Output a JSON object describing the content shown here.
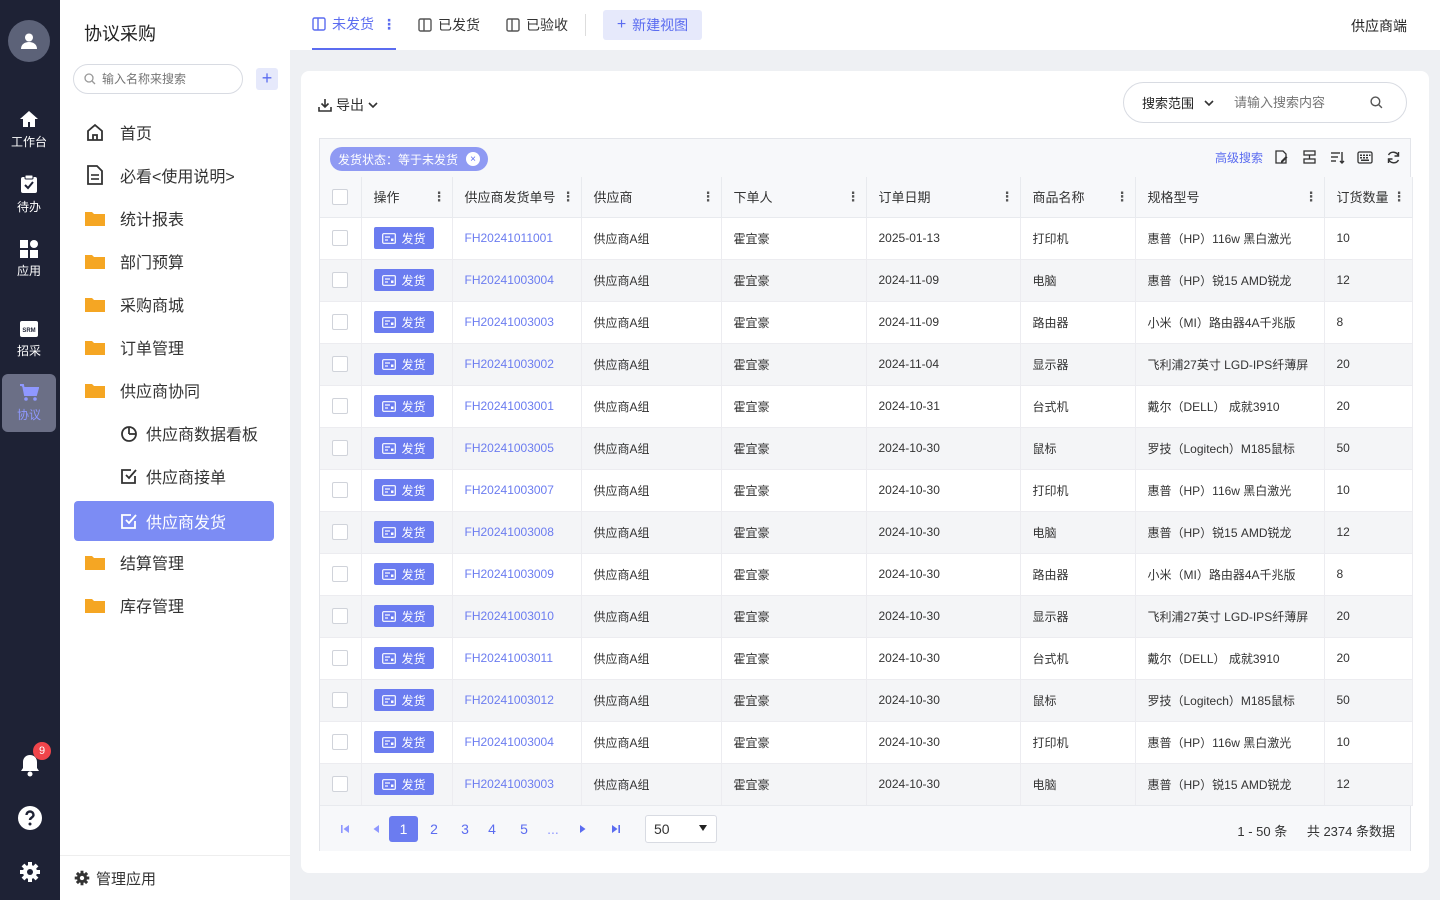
{
  "rail": {
    "items": [
      {
        "label": "工作台",
        "icon": "home-icon"
      },
      {
        "label": "待办",
        "icon": "clipboard-icon"
      },
      {
        "label": "应用",
        "icon": "apps-icon"
      },
      {
        "label": "招采",
        "icon": "srm-icon"
      },
      {
        "label": "协议",
        "icon": "cart-icon"
      }
    ],
    "badge_count": "9",
    "srm_text": "SRM"
  },
  "sidebar": {
    "title": "协议采购",
    "search_placeholder": "输入名称来搜索",
    "add_label": "+",
    "items": [
      {
        "label": "首页"
      },
      {
        "label": "必看<使用说明>"
      },
      {
        "label": "统计报表"
      },
      {
        "label": "部门预算"
      },
      {
        "label": "采购商城"
      },
      {
        "label": "订单管理"
      },
      {
        "label": "供应商协同"
      },
      {
        "label": "供应商数据看板"
      },
      {
        "label": "供应商接单"
      },
      {
        "label": "供应商发货"
      },
      {
        "label": "结算管理"
      },
      {
        "label": "库存管理"
      }
    ],
    "manage_label": "管理应用"
  },
  "topbar": {
    "tabs": [
      {
        "label": "未发货"
      },
      {
        "label": "已发货"
      },
      {
        "label": "已验收"
      }
    ],
    "tab_more": "⋮",
    "new_view_plus": "+",
    "new_view": "新建视图",
    "supplier_end": "供应商端"
  },
  "toolbar": {
    "export_label": "导出",
    "scope_label": "搜索范围",
    "search_placeholder": "请输入搜索内容",
    "filter_tag": "发货状态：等于未发货",
    "filter_close": "×",
    "advanced_search": "高级搜索"
  },
  "table": {
    "headers": [
      "操作",
      "供应商发货单号",
      "供应商",
      "下单人",
      "订单日期",
      "商品名称",
      "规格型号",
      "订货数量"
    ],
    "action_label": "发货",
    "rows": [
      {
        "no": "FH20241011001",
        "supplier": "供应商A组",
        "orderer": "霍宜豪",
        "date": "2025-01-13",
        "product": "打印机",
        "spec": "惠普（HP）116w 黑白激光",
        "qty": "10"
      },
      {
        "no": "FH20241003004",
        "supplier": "供应商A组",
        "orderer": "霍宜豪",
        "date": "2024-11-09",
        "product": "电脑",
        "spec": "惠普（HP）锐15 AMD锐龙",
        "qty": "12"
      },
      {
        "no": "FH20241003003",
        "supplier": "供应商A组",
        "orderer": "霍宜豪",
        "date": "2024-11-09",
        "product": "路由器",
        "spec": "小米（MI）路由器4A千兆版",
        "qty": "8"
      },
      {
        "no": "FH20241003002",
        "supplier": "供应商A组",
        "orderer": "霍宜豪",
        "date": "2024-11-04",
        "product": "显示器",
        "spec": "飞利浦27英寸 LGD-IPS纤薄屏",
        "qty": "20"
      },
      {
        "no": "FH20241003001",
        "supplier": "供应商A组",
        "orderer": "霍宜豪",
        "date": "2024-10-31",
        "product": "台式机",
        "spec": "戴尔（DELL） 成就3910",
        "qty": "20"
      },
      {
        "no": "FH20241003005",
        "supplier": "供应商A组",
        "orderer": "霍宜豪",
        "date": "2024-10-30",
        "product": "鼠标",
        "spec": "罗技（Logitech）M185鼠标",
        "qty": "50"
      },
      {
        "no": "FH20241003007",
        "supplier": "供应商A组",
        "orderer": "霍宜豪",
        "date": "2024-10-30",
        "product": "打印机",
        "spec": "惠普（HP）116w 黑白激光",
        "qty": "10"
      },
      {
        "no": "FH20241003008",
        "supplier": "供应商A组",
        "orderer": "霍宜豪",
        "date": "2024-10-30",
        "product": "电脑",
        "spec": "惠普（HP）锐15 AMD锐龙",
        "qty": "12"
      },
      {
        "no": "FH20241003009",
        "supplier": "供应商A组",
        "orderer": "霍宜豪",
        "date": "2024-10-30",
        "product": "路由器",
        "spec": "小米（MI）路由器4A千兆版",
        "qty": "8"
      },
      {
        "no": "FH20241003010",
        "supplier": "供应商A组",
        "orderer": "霍宜豪",
        "date": "2024-10-30",
        "product": "显示器",
        "spec": "飞利浦27英寸 LGD-IPS纤薄屏",
        "qty": "20"
      },
      {
        "no": "FH20241003011",
        "supplier": "供应商A组",
        "orderer": "霍宜豪",
        "date": "2024-10-30",
        "product": "台式机",
        "spec": "戴尔（DELL） 成就3910",
        "qty": "20"
      },
      {
        "no": "FH20241003012",
        "supplier": "供应商A组",
        "orderer": "霍宜豪",
        "date": "2024-10-30",
        "product": "鼠标",
        "spec": "罗技（Logitech）M185鼠标",
        "qty": "50"
      },
      {
        "no": "FH20241003004",
        "supplier": "供应商A组",
        "orderer": "霍宜豪",
        "date": "2024-10-30",
        "product": "打印机",
        "spec": "惠普（HP）116w 黑白激光",
        "qty": "10"
      },
      {
        "no": "FH20241003003",
        "supplier": "供应商A组",
        "orderer": "霍宜豪",
        "date": "2024-10-30",
        "product": "电脑",
        "spec": "惠普（HP）锐15 AMD锐龙",
        "qty": "12"
      }
    ]
  },
  "pagination": {
    "pages": [
      "1",
      "2",
      "3",
      "4",
      "5",
      "..."
    ],
    "current_page": "1",
    "page_size": "50",
    "range": "1 - 50 条",
    "total": "共 2374 条数据"
  },
  "colors": {
    "accent": "#6b7cf0",
    "rail_bg": "#1e2235",
    "badge": "#f0454b"
  }
}
